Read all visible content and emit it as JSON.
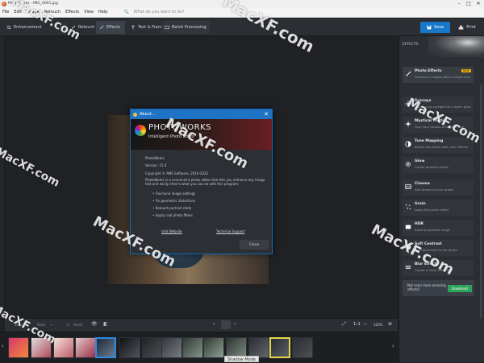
{
  "window": {
    "title": "PhotoWorks - IMG_0001.jpg",
    "controls": [
      "–",
      "□",
      "✕"
    ]
  },
  "menu": {
    "items": [
      "File",
      "Edit",
      "Image",
      "Retouch",
      "Effects",
      "View",
      "Help"
    ],
    "search_hint": "What do you want to do?"
  },
  "toolbar": {
    "tabs": [
      {
        "label": "Enhancement"
      },
      {
        "label": "Retouch"
      },
      {
        "label": "Effects"
      },
      {
        "label": "Text & Frames"
      },
      {
        "label": "Batch Processing"
      }
    ],
    "save_label": "Save",
    "print_label": "Print",
    "accent": "#1877c9"
  },
  "dialog": {
    "title": "About...",
    "brand": "PHOTOWORKS",
    "tagline": "Intelligent Photo Editor",
    "product": "PhotoWorks",
    "version": "Version: 15.0",
    "copyright": "Copyright © AMS Software, 2010-2022",
    "description_1": "PhotoWorks is a convenient photo editor that lets you enhance any image",
    "description_2": "fast and easily. Here's what you can do with this program:",
    "features": [
      "Fine-tune image settings",
      "Fix geometric distortions",
      "Retouch portrait shots",
      "Apply cool photo filters"
    ],
    "visit_link": "Visit Website",
    "support_link": "Technical Support",
    "close_label": "Close"
  },
  "effects_panel": {
    "title": "EFFECTS",
    "items": [
      {
        "name": "Photo Effects",
        "desc": "Transform images with a single click",
        "badge": "NEW"
      },
      {
        "name": "Sunrays",
        "desc": "Add rays of sunlight for a warm glow"
      },
      {
        "name": "Mystical Photo",
        "desc": "Give your photos a magical vibe"
      },
      {
        "name": "Tone Mapping",
        "desc": "Stylize the photo with color effects"
      },
      {
        "name": "Glow",
        "desc": "Create beautiful halos"
      },
      {
        "name": "Cinema",
        "desc": "Add drama to your photo"
      },
      {
        "name": "Grain",
        "desc": "Apply film grain effect"
      },
      {
        "name": "HDR",
        "desc": "Expand dynamic range"
      },
      {
        "name": "Soft Contrast",
        "desc": "Add dimension to the photo"
      },
      {
        "name": "Blur Effect",
        "desc": "Create a fuzzy wave feel"
      }
    ],
    "promo_text_1": "Not seen more amazing",
    "promo_text_2": "effects?",
    "promo_button": "Download"
  },
  "bottombar": {
    "back": "Back",
    "redo": "Redo",
    "reset": "Reset",
    "ratio": "1:1",
    "zoom": "100%"
  },
  "filmstrip": {
    "tooltip": "Shadow Mode",
    "thumbs": 14,
    "selected_index": 4
  },
  "watermark": "MacXF.com"
}
